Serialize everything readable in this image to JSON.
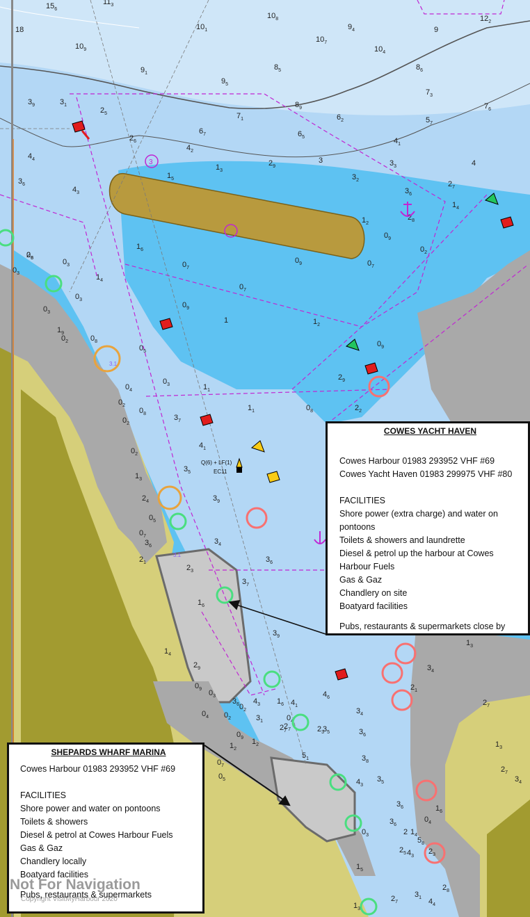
{
  "map": {
    "colors": {
      "deep_water": "#cfe6f8",
      "mid_water": "#b3d7f5",
      "shallow_water": "#5ec2f2",
      "land": "#d6cf7a",
      "land_dark": "#a29b30",
      "built_area": "#a9a9a9",
      "restricted_line": "#c026d3",
      "marina_pontoon": "#8a8a8a",
      "buoy_red": "#e11d1d",
      "buoy_green": "#22c55e",
      "buoy_yellow": "#facc15"
    },
    "soundings": [
      {
        "v": "15",
        "s": "6"
      },
      {
        "v": "11",
        "s": "3"
      },
      {
        "v": "10",
        "s": "8"
      },
      {
        "v": "9",
        "s": "4"
      },
      {
        "v": "12",
        "s": "2"
      },
      {
        "v": "18",
        "s": ""
      },
      {
        "v": "10",
        "s": "1"
      },
      {
        "v": "10",
        "s": "9"
      },
      {
        "v": "9",
        "s": "1"
      },
      {
        "v": "8",
        "s": "5"
      },
      {
        "v": "8",
        "s": "6"
      },
      {
        "v": "10",
        "s": "7"
      },
      {
        "v": "10",
        "s": "4"
      },
      {
        "v": "9",
        "s": ""
      },
      {
        "v": "9",
        "s": "5"
      },
      {
        "v": "7",
        "s": "3"
      },
      {
        "v": "3",
        "s": "9"
      },
      {
        "v": "3",
        "s": "1"
      },
      {
        "v": "2",
        "s": "5"
      },
      {
        "v": "8",
        "s": "9"
      },
      {
        "v": "7",
        "s": "6"
      },
      {
        "v": "6",
        "s": "7"
      },
      {
        "v": "6",
        "s": "5"
      },
      {
        "v": "7",
        "s": "1"
      },
      {
        "v": "6",
        "s": "2"
      },
      {
        "v": "5",
        "s": "7"
      },
      {
        "v": "4",
        "s": "4"
      },
      {
        "v": "2",
        "s": "6"
      },
      {
        "v": "4",
        "s": "2"
      },
      {
        "v": "4",
        "s": "1"
      },
      {
        "v": "3",
        "s": "3"
      },
      {
        "v": "3",
        "s": "6"
      },
      {
        "v": "3",
        "s": ""
      },
      {
        "v": "4",
        "s": ""
      },
      {
        "v": "3",
        "s": "2"
      },
      {
        "v": "2",
        "s": "9"
      },
      {
        "v": "1",
        "s": "5"
      },
      {
        "v": "1",
        "s": "3"
      },
      {
        "v": "2",
        "s": "7"
      },
      {
        "v": "4",
        "s": "3"
      },
      {
        "v": "3",
        "s": "6"
      },
      {
        "v": "2",
        "s": "8"
      },
      {
        "v": "1",
        "s": "4"
      },
      {
        "v": "1",
        "s": "6"
      },
      {
        "v": "0",
        "s": "9"
      },
      {
        "v": "1",
        "s": "2"
      },
      {
        "v": "0",
        "s": "3"
      },
      {
        "v": "0",
        "s": "2"
      },
      {
        "v": "0",
        "s": "9"
      },
      {
        "v": "0",
        "s": "7"
      },
      {
        "v": "0",
        "s": "7"
      },
      {
        "v": "0",
        "s": "7"
      },
      {
        "v": "0",
        "s": "9"
      },
      {
        "v": "1",
        "s": "2"
      },
      {
        "v": "1",
        "s": ""
      },
      {
        "v": "1",
        "s": "4"
      },
      {
        "v": "1",
        "s": "1"
      },
      {
        "v": "0",
        "s": "9"
      },
      {
        "v": "0",
        "s": "8"
      },
      {
        "v": "1",
        "s": "1"
      },
      {
        "v": "2",
        "s": "9"
      },
      {
        "v": "2",
        "s": "2"
      },
      {
        "v": "3",
        "s": "7"
      },
      {
        "v": "4",
        "s": "1"
      },
      {
        "v": "3",
        "s": "5"
      },
      {
        "v": "3",
        "s": "9"
      },
      {
        "v": "3",
        "s": "4"
      },
      {
        "v": "3",
        "s": "6"
      },
      {
        "v": "3",
        "s": "7"
      },
      {
        "v": "3",
        "s": "9"
      },
      {
        "v": "4",
        "s": "6"
      },
      {
        "v": "5",
        "s": "1"
      },
      {
        "v": "3",
        "s": "5"
      },
      {
        "v": "2",
        "s": "3"
      },
      {
        "v": "3",
        "s": "6"
      },
      {
        "v": "3",
        "s": "8"
      },
      {
        "v": "3",
        "s": "4"
      },
      {
        "v": "2",
        "s": "7"
      },
      {
        "v": "4",
        "s": "3"
      },
      {
        "v": "3",
        "s": "5"
      },
      {
        "v": "3",
        "s": "6"
      },
      {
        "v": "1",
        "s": "5"
      },
      {
        "v": "1",
        "s": "3"
      },
      {
        "v": "2",
        "s": "5"
      },
      {
        "v": "2",
        "s": "7"
      },
      {
        "v": "3",
        "s": "6"
      },
      {
        "v": "4",
        "s": "3"
      },
      {
        "v": "5",
        "s": "8"
      },
      {
        "v": "3",
        "s": "4"
      },
      {
        "v": "2",
        "s": "1"
      },
      {
        "v": "1",
        "s": "2"
      },
      {
        "v": "3",
        "s": "1"
      },
      {
        "v": "1",
        "s": "6"
      },
      {
        "v": "0",
        "s": "4"
      },
      {
        "v": "3",
        "s": "6"
      },
      {
        "v": "4",
        "s": "3"
      },
      {
        "v": "4",
        "s": "1"
      },
      {
        "v": "2",
        "s": "7"
      },
      {
        "v": "2",
        "s": "8"
      },
      {
        "v": "0",
        "s": "3"
      },
      {
        "v": "1",
        "s": "9"
      },
      {
        "v": "0",
        "s": "3"
      },
      {
        "v": "0",
        "s": "2"
      },
      {
        "v": "0",
        "s": "8"
      },
      {
        "v": "0",
        "s": "5"
      },
      {
        "v": "0",
        "s": "3"
      },
      {
        "v": "0",
        "s": "2"
      },
      {
        "v": "0",
        "s": "2"
      },
      {
        "v": "1",
        "s": "3"
      },
      {
        "v": "2",
        "s": "4"
      },
      {
        "v": "3",
        "s": "6"
      },
      {
        "v": "2",
        "s": "1"
      },
      {
        "v": "0",
        "s": "5"
      },
      {
        "v": "0",
        "s": "7"
      },
      {
        "v": "0",
        "s": "6"
      },
      {
        "v": "0",
        "s": "3"
      },
      {
        "v": "0",
        "s": "2"
      },
      {
        "v": "0",
        "s": "4"
      },
      {
        "v": "0",
        "s": "8"
      },
      {
        "v": "2",
        "s": "3"
      },
      {
        "v": "1",
        "s": "6"
      },
      {
        "v": "1",
        "s": "4"
      },
      {
        "v": "2",
        "s": "9"
      },
      {
        "v": "0",
        "s": "9"
      },
      {
        "v": "0",
        "s": "4"
      },
      {
        "v": "0",
        "s": "2"
      },
      {
        "v": "0",
        "s": "2"
      },
      {
        "v": "0",
        "s": "9"
      },
      {
        "v": "1",
        "s": "2"
      },
      {
        "v": "0",
        "s": "3"
      },
      {
        "v": "0",
        "s": "7"
      },
      {
        "v": "0",
        "s": "5"
      },
      {
        "v": "0",
        "s": "3"
      },
      {
        "v": "1",
        "s": "4"
      },
      {
        "v": "2",
        "s": "3"
      },
      {
        "v": "2",
        "s": "8"
      },
      {
        "v": "1",
        "s": "6"
      },
      {
        "v": "0",
        "s": "4"
      },
      {
        "v": "2",
        "s": ""
      },
      {
        "v": "3",
        "s": "1"
      },
      {
        "v": "4",
        "s": "4"
      },
      {
        "v": "1",
        "s": "3"
      },
      {
        "v": "2",
        "s": "7"
      },
      {
        "v": "1",
        "s": "3"
      },
      {
        "v": "2",
        "s": "7"
      },
      {
        "v": "3",
        "s": "4"
      }
    ],
    "labels": {
      "light_characteristic": "Q(6) + LF(1)",
      "buoy_name": "EC11",
      "restricted_area_number": "3",
      "area_code_a": "3.1",
      "area_code_b": "3.1"
    }
  },
  "cowes_yacht_haven": {
    "title": "COWES YACHT HAVEN",
    "contacts": [
      "Cowes Harbour  01983 293952  VHF #69",
      "Cowes Yacht Haven  01983 299975  VHF #80"
    ],
    "facilities_heading": "FACILITIES",
    "facilities": [
      "Shore power (extra charge) and water on pontoons",
      "Toilets & showers and laundrette",
      "Diesel & petrol up the harbour at Cowes Harbour Fuels",
      "Gas & Gaz",
      "Chandlery on site",
      "Boatyard facilities"
    ],
    "footer": "Pubs, restaurants & supermarkets close by"
  },
  "shepards_wharf": {
    "title": "SHEPARDS WHARF MARINA",
    "contacts": [
      "Cowes Harbour  01983 293952  VHF #69"
    ],
    "facilities_heading": "FACILITIES",
    "facilities": [
      "Shore power  and water on pontoons",
      "Toilets & showers",
      "Diesel & petrol at Cowes Harbour Fuels",
      "Gas & Gaz",
      "Chandlery locally",
      "Boatyard facilities"
    ],
    "footer": "Pubs, restaurants & supermarkets"
  },
  "watermark": {
    "text": "Not For Navigation",
    "copyright": "Copyright VisitMyHarbour 2020"
  }
}
